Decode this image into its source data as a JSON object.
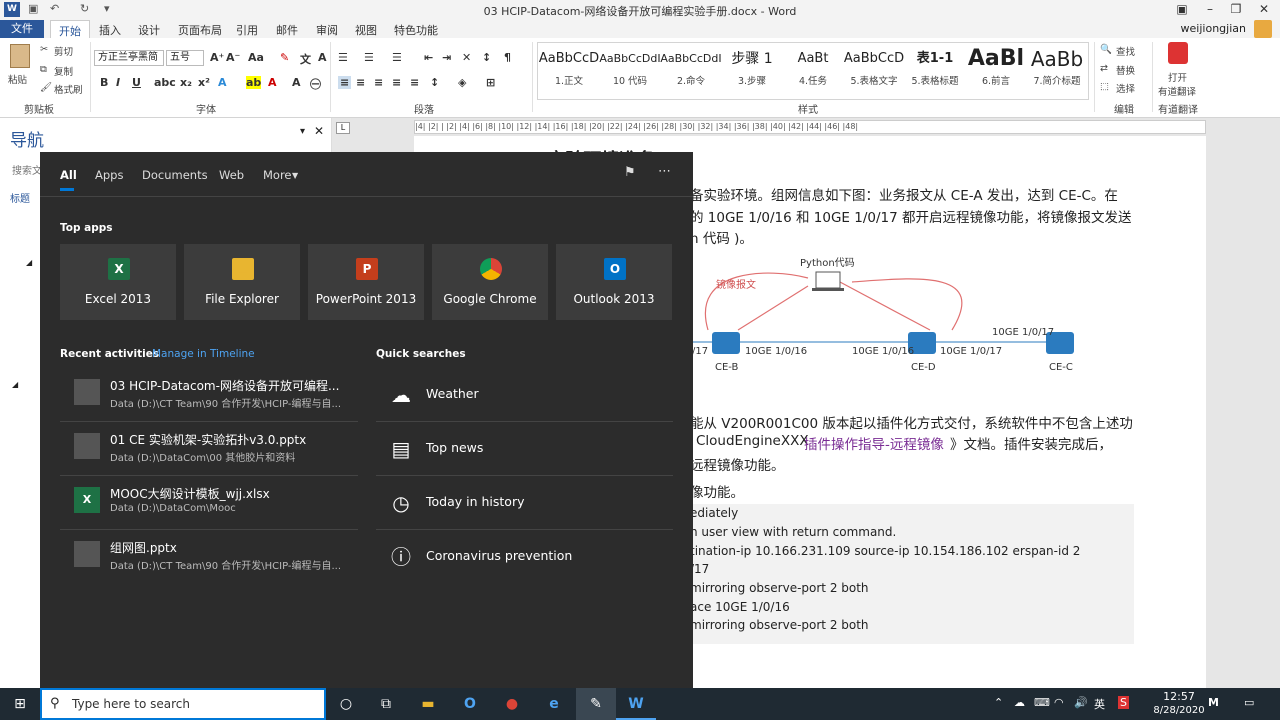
{
  "window": {
    "title": "03 HCIP-Datacom-网络设备开放可编程实验手册.docx - Word",
    "user": "weijiongjian"
  },
  "ribbon_tabs": [
    "文件",
    "开始",
    "插入",
    "设计",
    "页面布局",
    "引用",
    "邮件",
    "审阅",
    "视图",
    "特色功能"
  ],
  "ribbon": {
    "paste": "粘贴",
    "cut": "剪切",
    "copy": "复制",
    "format_painter": "格式刷",
    "clipboard_group": "剪贴板",
    "font_name": "方正兰亭黑简",
    "font_size": "五号",
    "font_group": "字体",
    "paragraph_group": "段落",
    "styles_group": "样式",
    "editing_group": "编辑",
    "find": "查找",
    "replace": "替换",
    "select": "选择",
    "translate_open": "打开",
    "translate_label": "有道翻译",
    "translate_group": "有道翻译",
    "styles": [
      {
        "preview": "AaBbCcD",
        "name": "1.正文"
      },
      {
        "preview": "AaBbCcDdI",
        "name": "10 代码"
      },
      {
        "preview": "AaBbCcDdI",
        "name": "2.命令"
      },
      {
        "preview": "步骤 1",
        "name": "3.步骤"
      },
      {
        "preview": "AaBt",
        "name": "4.任务"
      },
      {
        "preview": "AaBbCcD",
        "name": "5.表格文字"
      },
      {
        "preview": "表1-1",
        "name": "5.表格标题"
      },
      {
        "preview": "AaBl",
        "name": "6.前言"
      },
      {
        "preview": "AaBb",
        "name": "7.简介标题"
      }
    ]
  },
  "nav": {
    "title": "导航",
    "search_placeholder": "搜索文",
    "tab_headings": "标题"
  },
  "ruler_text": "|4| |2| |   |2| |4| |6| |8| |10| |12| |14| |16| |18| |20| |22| |24| |26| |28| |30| |32| |34| |36| |38| |40| |42| |44| |46| |48|",
  "document": {
    "heading_partial": "2.1.2 实验环境准备",
    "line1": "备实验环境。组网信息如下图：业务报文从 CE-A 发出，达到 CE-C。在",
    "line2": "的 10GE 1/0/16 和 10GE 1/0/17 都开启远程镜像功能，将镜像报文发送",
    "line3": "n 代码 )。",
    "diagram": {
      "python_label": "Python代码",
      "mirror_label": "镜像报文",
      "ceb": "CE-B",
      "ced": "CE-D",
      "cec": "CE-C",
      "port_17_left": "/17",
      "ceb_16": "10GE 1/0/16",
      "ced_16": "10GE 1/0/16",
      "ced_17": "10GE 1/0/17",
      "cec_17": "10GE 1/0/17"
    },
    "para2_line1": "能从 V200R001C00 版本起以插件化方式交付，系统软件中不包含上述功",
    "para2_line2_a": "CloudEngineXXX ",
    "para2_line2_link": "插件操作指导-远程镜像",
    "para2_line2_b": " 》文档。插件安装完成后，",
    "para2_line3": "远程镜像功能。",
    "para3": "像功能。",
    "code": [
      "ediately",
      "n user view with return command.",
      "tination-ip 10.166.231.109 source-ip 10.154.186.102 erspan-id 2",
      "/17",
      "mirroring observe-port 2 both",
      "ace 10GE 1/0/16",
      "mirroring observe-port 2 both"
    ]
  },
  "start_menu": {
    "tabs": [
      "All",
      "Apps",
      "Documents",
      "Web",
      "More"
    ],
    "top_apps_title": "Top apps",
    "apps": [
      {
        "name": "Excel 2013",
        "glyph": "X",
        "color": "#1e7145"
      },
      {
        "name": "File Explorer",
        "glyph": "▬",
        "color": "#e8b530"
      },
      {
        "name": "PowerPoint 2013",
        "glyph": "P",
        "color": "#c43e1c"
      },
      {
        "name": "Google Chrome",
        "glyph": "●",
        "color": "#db4437"
      },
      {
        "name": "Outlook 2013",
        "glyph": "O",
        "color": "#0072c6"
      }
    ],
    "recent_title": "Recent activities",
    "manage_timeline": "Manage in Timeline",
    "recent": [
      {
        "title": "03 HCIP-Datacom-网络设备开放可编程...",
        "path": "Data (D:)\\CT Team\\90 合作开发\\HCIP-编程与自..."
      },
      {
        "title": "01 CE 实验机架-实验拓扑v3.0.pptx",
        "path": "Data (D:)\\DataCom\\00 其他胶片和资料"
      },
      {
        "title": "MOOC大纲设计模板_wjj.xlsx",
        "path": "Data (D:)\\DataCom\\Mooc"
      },
      {
        "title": "组网图.pptx",
        "path": "Data (D:)\\CT Team\\90 合作开发\\HCIP-编程与自..."
      }
    ],
    "quick_title": "Quick searches",
    "quick": [
      {
        "label": "Weather",
        "icon": "☁"
      },
      {
        "label": "Top news",
        "icon": "▤"
      },
      {
        "label": "Today in history",
        "icon": "◷"
      },
      {
        "label": "Coronavirus prevention",
        "icon": "ⓘ"
      }
    ]
  },
  "taskbar": {
    "search_placeholder": "Type here to search",
    "time": "12:57",
    "date": "8/28/2020",
    "lang": "英"
  }
}
